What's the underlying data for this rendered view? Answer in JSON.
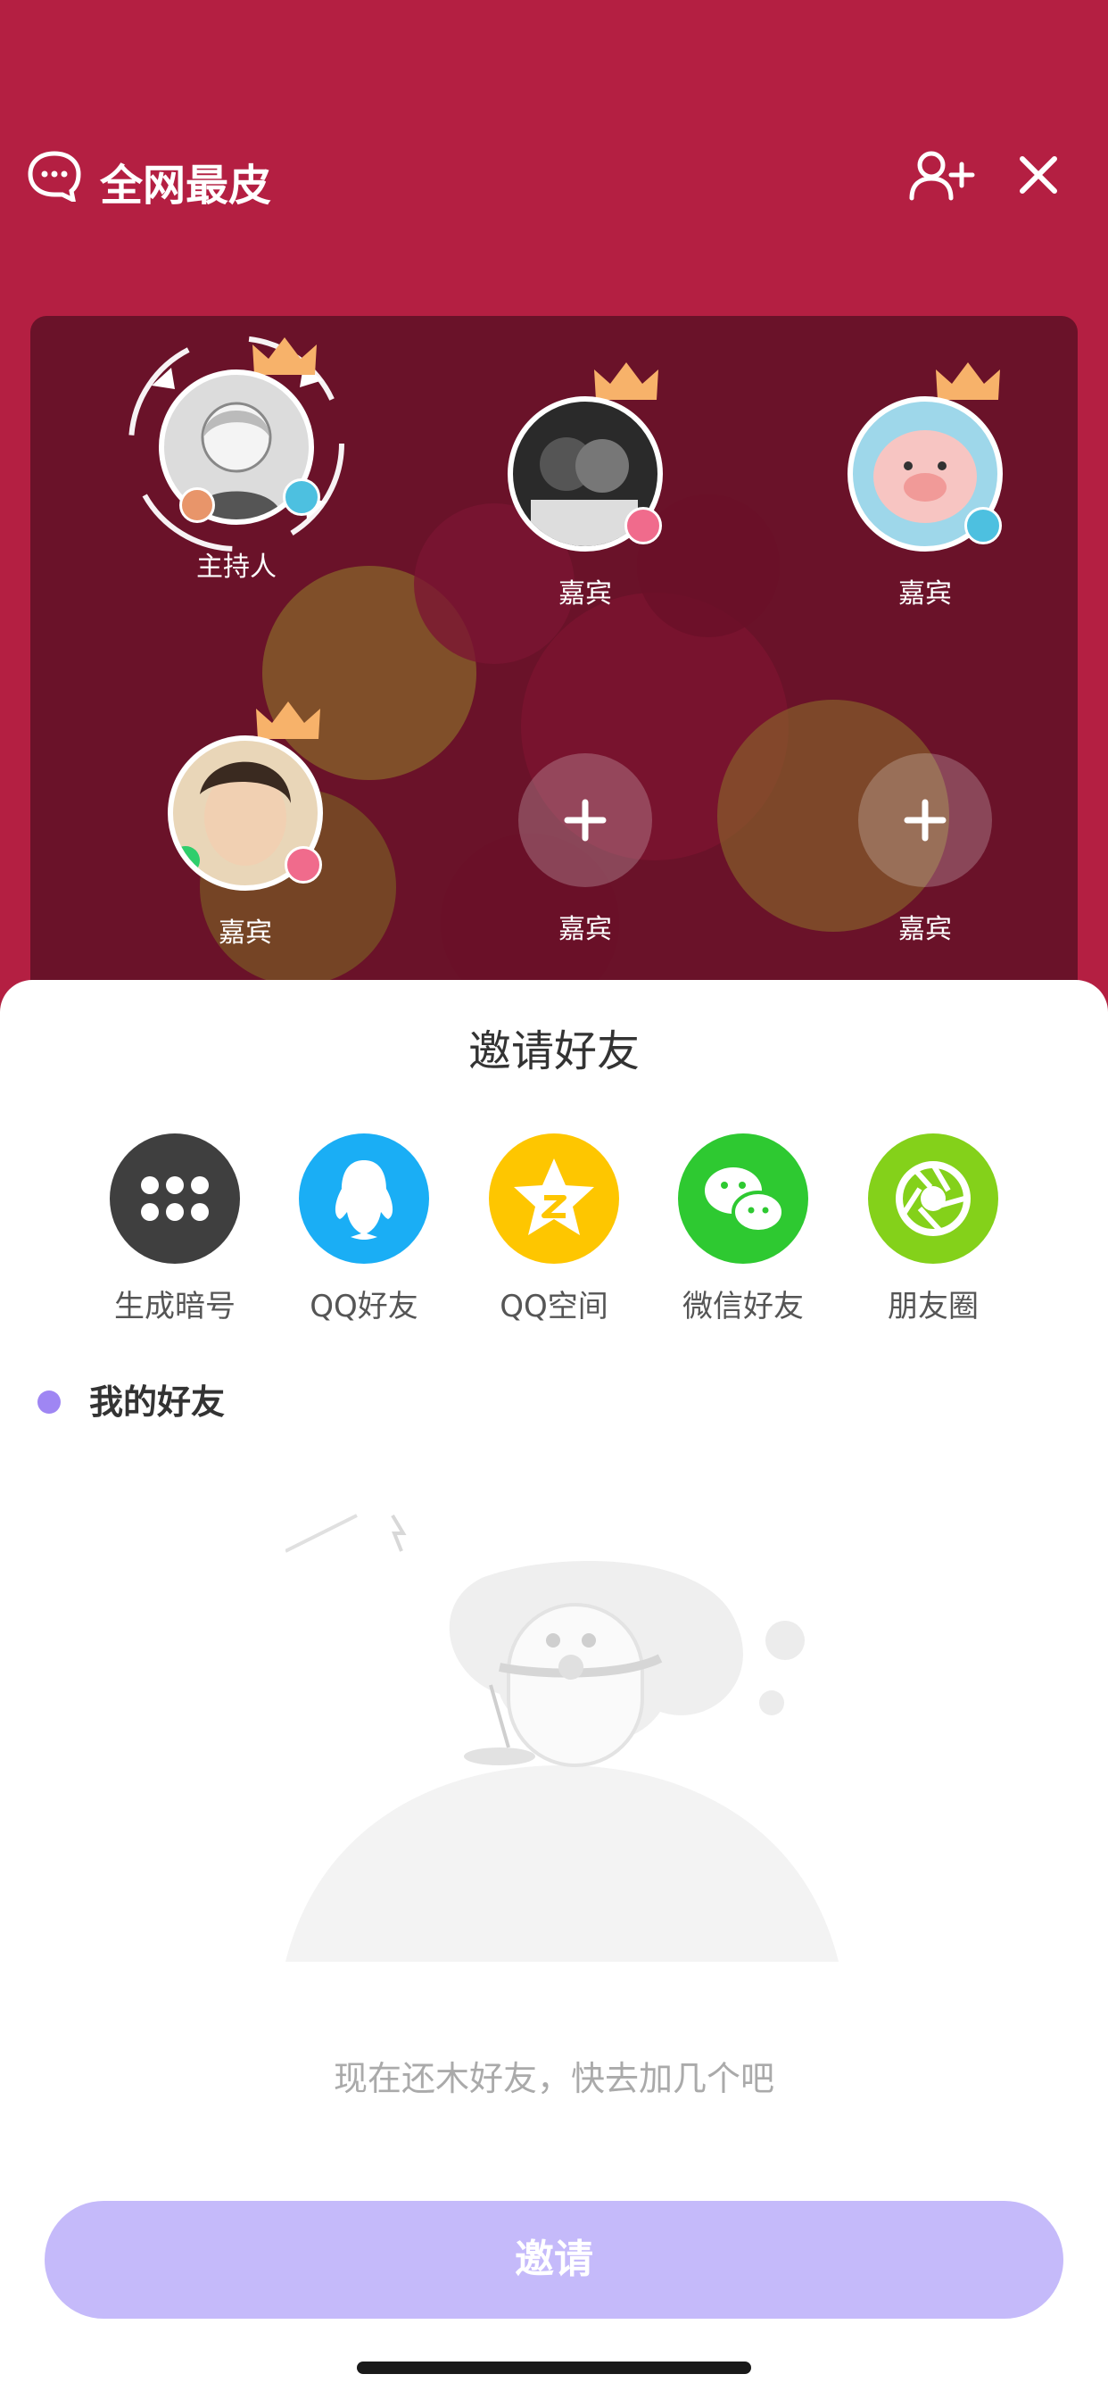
{
  "header": {
    "room_title": "全网最皮",
    "icons": [
      "chat-icon",
      "add-user-icon",
      "close-icon"
    ]
  },
  "seats": [
    {
      "label": "主持人",
      "role": "host",
      "has_avatar": true,
      "mic_color": "#4dc0e0"
    },
    {
      "label": "嘉宾",
      "role": "guest",
      "has_avatar": true,
      "mic_color": "#f06b8c"
    },
    {
      "label": "嘉宾",
      "role": "guest",
      "has_avatar": true,
      "mic_color": "#4dc0e0"
    },
    {
      "label": "嘉宾",
      "role": "guest",
      "has_avatar": true,
      "mic_color": "#f06b8c"
    },
    {
      "label": "嘉宾",
      "role": "empty",
      "has_avatar": false
    },
    {
      "label": "嘉宾",
      "role": "empty",
      "has_avatar": false
    }
  ],
  "sheet": {
    "title": "邀请好友",
    "share_options": [
      {
        "label": "生成暗号",
        "icon": "dots-icon",
        "color": "#3f3f3f"
      },
      {
        "label": "QQ好友",
        "icon": "qq-penguin-icon",
        "color": "#1aaef5"
      },
      {
        "label": "QQ空间",
        "icon": "qzone-star-icon",
        "color": "#fec600"
      },
      {
        "label": "微信好友",
        "icon": "wechat-icon",
        "color": "#2ec931"
      },
      {
        "label": "朋友圈",
        "icon": "moments-shutter-icon",
        "color": "#84d11a"
      }
    ],
    "friends_heading": "我的好友",
    "empty_text": "现在还木好友，快去加几个吧",
    "invite_button": "邀请"
  },
  "colors": {
    "background": "#b41f42",
    "accent_purple": "#9f86f3",
    "invite_button": "#c5bafa"
  }
}
